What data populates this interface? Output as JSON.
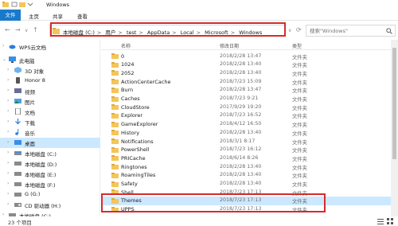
{
  "window": {
    "title": "Windows"
  },
  "ribbon": {
    "tabs": [
      "文件",
      "主页",
      "共享",
      "查看"
    ]
  },
  "address": {
    "crumbs": [
      "本地磁盘 (C:)",
      "用户",
      "test",
      "AppData",
      "Local",
      "Microsoft",
      "Windows"
    ],
    "separator": ">"
  },
  "search": {
    "placeholder": "搜索\"Windows\""
  },
  "sidebar": {
    "items": [
      {
        "label": "WPS云文档",
        "icon": "cloud-icon"
      },
      {
        "label": "此电脑",
        "icon": "computer-icon"
      },
      {
        "label": "3D 对象",
        "icon": "cube-icon"
      },
      {
        "label": "Honor 8",
        "icon": "phone-icon"
      },
      {
        "label": "视频",
        "icon": "video-icon"
      },
      {
        "label": "图片",
        "icon": "picture-icon"
      },
      {
        "label": "文档",
        "icon": "document-icon"
      },
      {
        "label": "下载",
        "icon": "download-icon"
      },
      {
        "label": "音乐",
        "icon": "music-icon"
      },
      {
        "label": "桌面",
        "icon": "desktop-icon"
      },
      {
        "label": "本地磁盘 (C:)",
        "icon": "drive-icon"
      },
      {
        "label": "本地磁盘 (D:)",
        "icon": "drive-icon"
      },
      {
        "label": "本地磁盘 (E:)",
        "icon": "drive-icon"
      },
      {
        "label": "本地磁盘 (F:)",
        "icon": "drive-icon"
      },
      {
        "label": "G (G:)",
        "icon": "drive-icon"
      },
      {
        "label": "CD 驱动器 (H:)",
        "icon": "cd-drive-icon"
      },
      {
        "label": "本地磁盘 (C:)",
        "icon": "drive-icon"
      }
    ]
  },
  "columns": {
    "name": "名称",
    "date": "修改日期",
    "type": "类型"
  },
  "files": [
    {
      "name": "0",
      "date": "2018/2/28 13:47",
      "type": "文件夹"
    },
    {
      "name": "1024",
      "date": "2018/2/28 13:40",
      "type": "文件夹"
    },
    {
      "name": "2052",
      "date": "2018/2/28 13:40",
      "type": "文件夹"
    },
    {
      "name": "ActionCenterCache",
      "date": "2018/7/23 15:09",
      "type": "文件夹"
    },
    {
      "name": "Burn",
      "date": "2018/2/28 13:47",
      "type": "文件夹"
    },
    {
      "name": "Caches",
      "date": "2018/7/23 9:21",
      "type": "文件夹"
    },
    {
      "name": "CloudStore",
      "date": "2017/9/29 19:20",
      "type": "文件夹"
    },
    {
      "name": "Explorer",
      "date": "2018/7/23 16:52",
      "type": "文件夹"
    },
    {
      "name": "GameExplorer",
      "date": "2018/4/12 16:50",
      "type": "文件夹"
    },
    {
      "name": "History",
      "date": "2018/2/28 13:40",
      "type": "文件夹"
    },
    {
      "name": "Notifications",
      "date": "2018/3/1 8:17",
      "type": "文件夹"
    },
    {
      "name": "PowerShell",
      "date": "2018/7/23 16:12",
      "type": "文件夹"
    },
    {
      "name": "PRICache",
      "date": "2018/6/14 8:26",
      "type": "文件夹"
    },
    {
      "name": "Ringtones",
      "date": "2018/2/28 13:40",
      "type": "文件夹"
    },
    {
      "name": "RoamingTiles",
      "date": "2018/2/28 13:40",
      "type": "文件夹"
    },
    {
      "name": "Safety",
      "date": "2018/2/28 13:40",
      "type": "文件夹"
    },
    {
      "name": "Shell",
      "date": "2018/7/23 17:13",
      "type": "文件夹"
    },
    {
      "name": "Themes",
      "date": "2018/7/23 17:13",
      "type": "文件夹"
    },
    {
      "name": "UPPS",
      "date": "2018/7/23 17:13",
      "type": "文件夹"
    }
  ],
  "selected_file_index": 17,
  "status": {
    "count_text": "23 个项目"
  },
  "colors": {
    "accent": "#1979ca",
    "selection": "#cce8ff",
    "highlight_box": "#d62b2b",
    "folder": "#f4c55a"
  }
}
